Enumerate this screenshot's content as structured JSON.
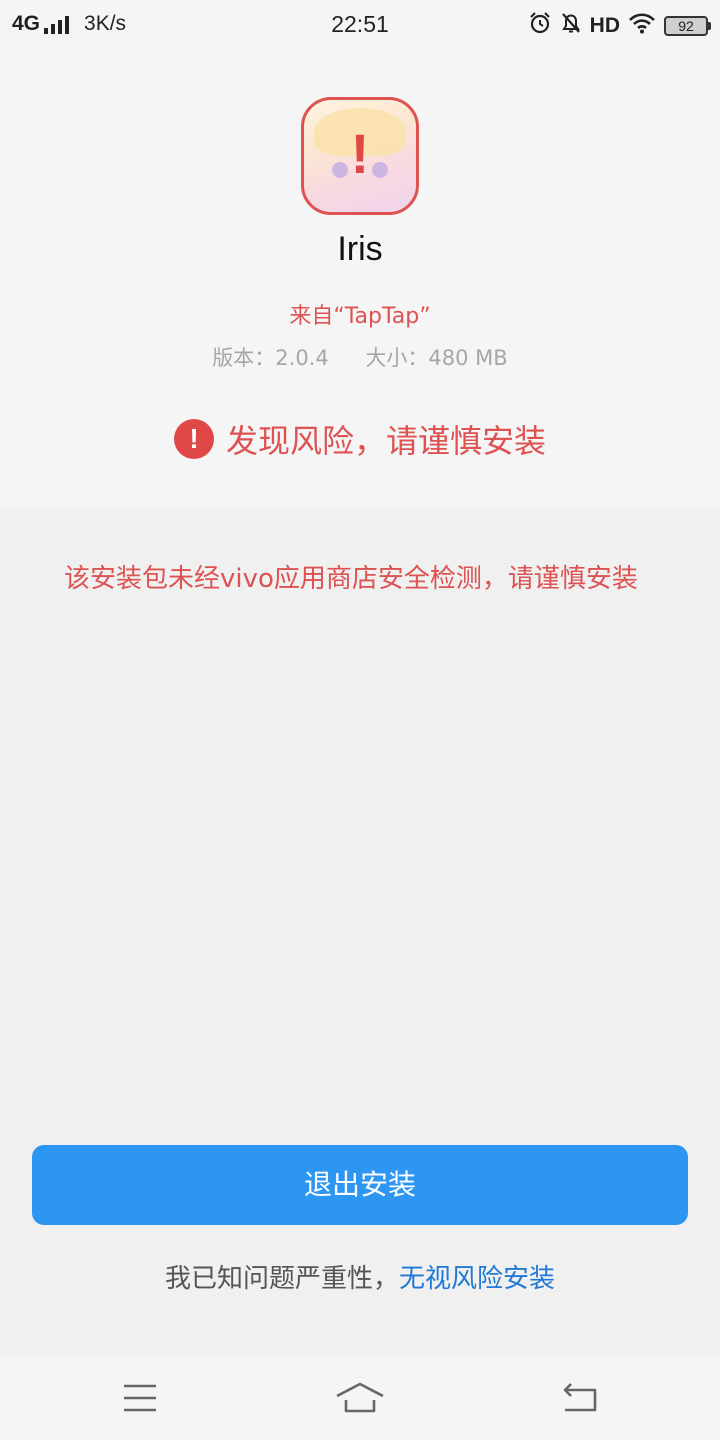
{
  "status_bar": {
    "network": "4G",
    "speed": "3K/s",
    "time": "22:51",
    "hd": "HD",
    "battery": "92",
    "icons": [
      "alarm-icon",
      "mute-icon",
      "wifi-icon",
      "battery-icon"
    ]
  },
  "app": {
    "name": "Iris",
    "source": "来自“TapTap”",
    "version": "版本：2.0.4",
    "size": "大小：480 MB"
  },
  "risk": {
    "headline": "发现风险，请谨慎安装",
    "icon": "alert-icon",
    "message": "该安装包未经vivo应用商店安全检测，请谨慎安装"
  },
  "actions": {
    "exit_label": "退出安装",
    "ignore_prefix": "我已知问题严重性，",
    "ignore_link": "无视风险安装"
  },
  "nav": {
    "icons": [
      "menu-icon",
      "home-icon",
      "back-icon"
    ]
  },
  "colors": {
    "risk_red": "#de5252",
    "primary_blue": "#2d96f3",
    "link_blue": "#2079d4"
  }
}
